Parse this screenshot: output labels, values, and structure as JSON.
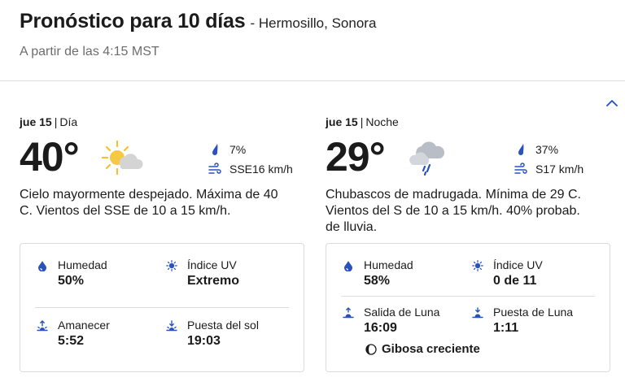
{
  "header": {
    "title": "Pronóstico para 10 días",
    "location": "- Hermosillo, Sonora",
    "subtitle": "A partir de las 4:15 MST"
  },
  "day": {
    "date": "jue 15",
    "period": "Día",
    "temp": "40°",
    "weather_icon": "mostly-sunny-icon",
    "precip": "7%",
    "wind": "SSE16 km/h",
    "description": "Cielo mayormente despejado. Máxima de 40 C. Vientos del SSE de 10 a 15 km/h.",
    "details": {
      "humidity_label": "Humedad",
      "humidity_value": "50%",
      "uv_label": "Índice UV",
      "uv_value": "Extremo",
      "rise_label": "Amanecer",
      "rise_value": "5:52",
      "set_label": "Puesta del sol",
      "set_value": "19:03"
    }
  },
  "night": {
    "date": "jue 15",
    "period": "Noche",
    "temp": "29°",
    "weather_icon": "rain-showers-icon",
    "precip": "37%",
    "wind": "S17 km/h",
    "description": "Chubascos de madrugada. Mínima de 29 C. Vientos del S de 10 a 15 km/h. 40% probab. de lluvia.",
    "details": {
      "humidity_label": "Humedad",
      "humidity_value": "58%",
      "uv_label": "Índice UV",
      "uv_value": "0 de 11",
      "rise_label": "Salida de Luna",
      "rise_value": "16:09",
      "set_label": "Puesta de Luna",
      "set_value": "1:11",
      "moon_phase": "Gibosa creciente"
    }
  },
  "colors": {
    "accent": "#1f4fd8",
    "icon_blue": "#2a52be",
    "sun": "#f6c945"
  }
}
